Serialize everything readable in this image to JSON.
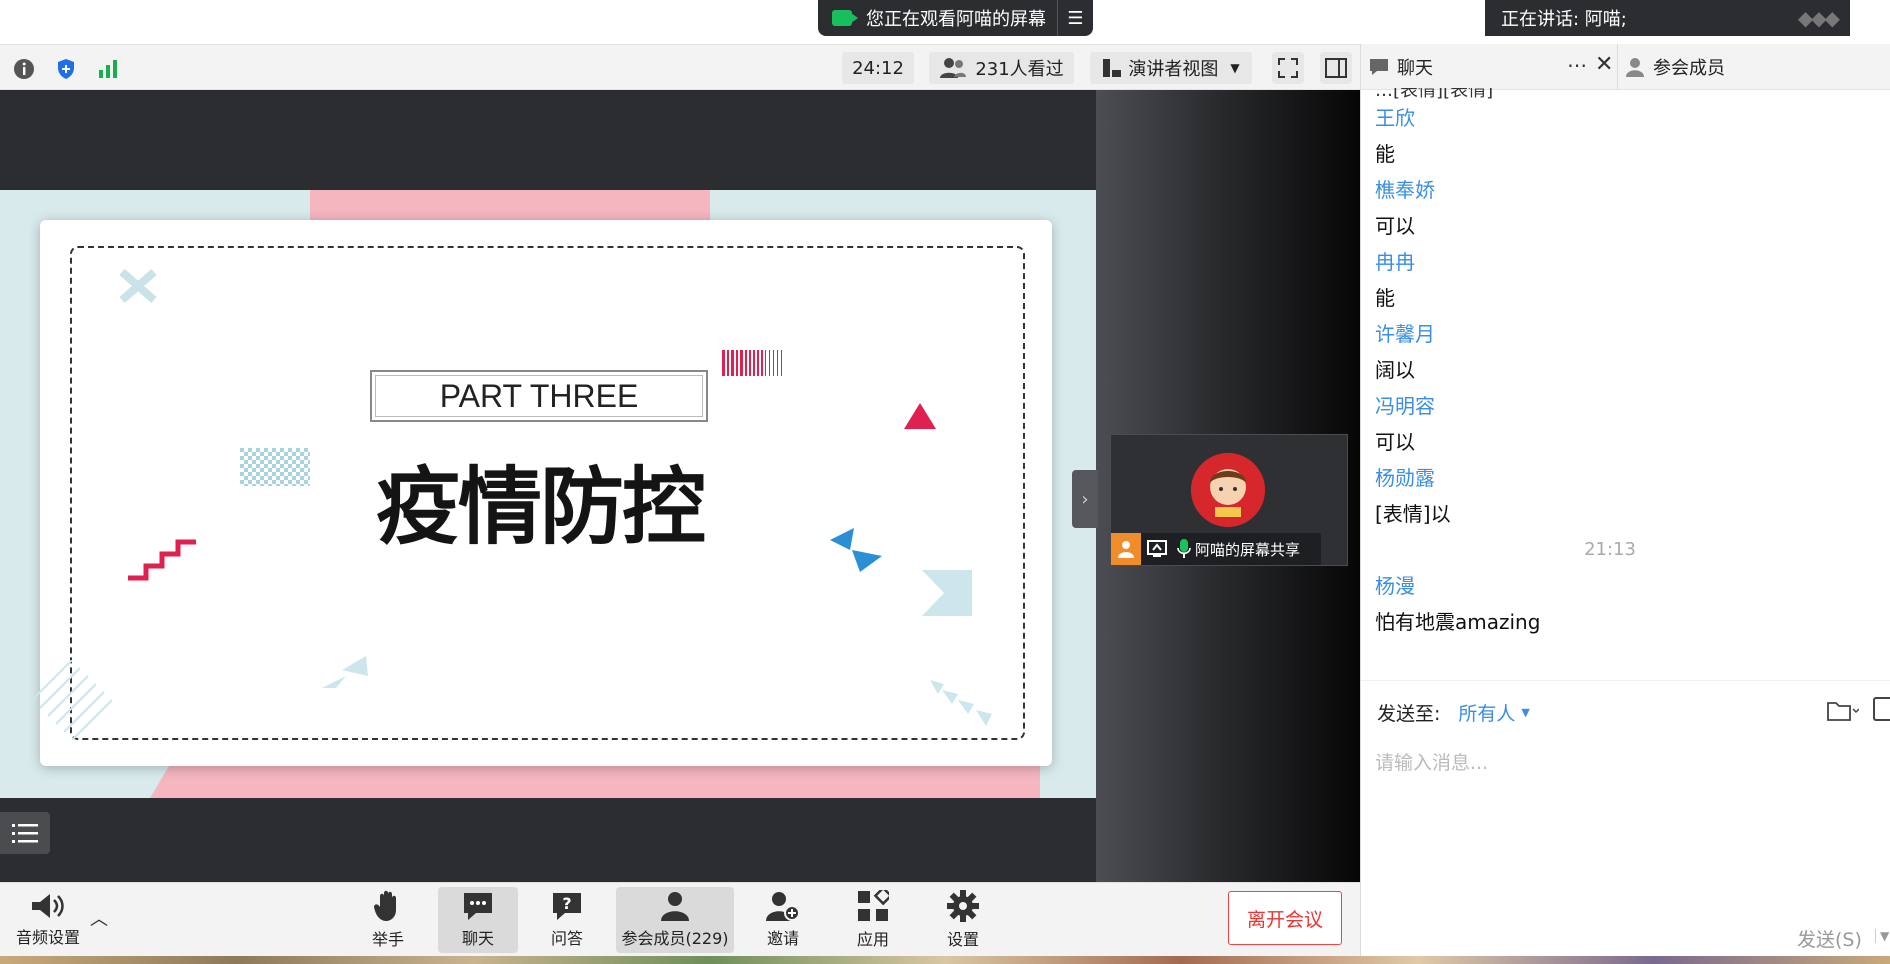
{
  "banner": {
    "viewing_text": "您正在观看阿喵的屏幕",
    "speaker_text": "正在讲话: 阿喵;"
  },
  "toolbar": {
    "duration": "24:12",
    "viewers": "231人看过",
    "view_mode": "演讲者视图"
  },
  "slide": {
    "part_label": "PART THREE",
    "main_title": "疫情防控"
  },
  "participant_tile": {
    "name": "阿喵的屏幕共享"
  },
  "bottom_bar": {
    "audio_settings": "音频设置",
    "raise_hand": "举手",
    "chat": "聊天",
    "qa": "问答",
    "participants": "参会成员(229)",
    "invite": "邀请",
    "apps": "应用",
    "settings": "设置",
    "leave": "离开会议"
  },
  "panel": {
    "chat_tab": "聊天",
    "members_tab": "参会成员",
    "partial_top_text": "…[表情][表情]",
    "messages": [
      {
        "sender": "王欣",
        "text": "能"
      },
      {
        "sender": "樵奉娇",
        "text": "可以"
      },
      {
        "sender": "冉冉",
        "text": "能"
      },
      {
        "sender": "许馨月",
        "text": "阔以"
      },
      {
        "sender": "冯明容",
        "text": "可以"
      },
      {
        "sender": "杨勋露",
        "text": "[表情]以"
      }
    ],
    "timestamp": "21:13",
    "last_message": {
      "sender": "杨漫",
      "text": "怕有地震amazing"
    },
    "send_to_label": "发送至:",
    "send_to_value": "所有人",
    "input_placeholder": "请输入消息...",
    "send_button": "发送(S)"
  },
  "colors": {
    "accent_blue": "#3a8ee6",
    "leave_red": "#e33333",
    "stage_dark": "#2b2d31",
    "slide_pink": "#f5b6c0",
    "slide_red": "#e0204e"
  }
}
